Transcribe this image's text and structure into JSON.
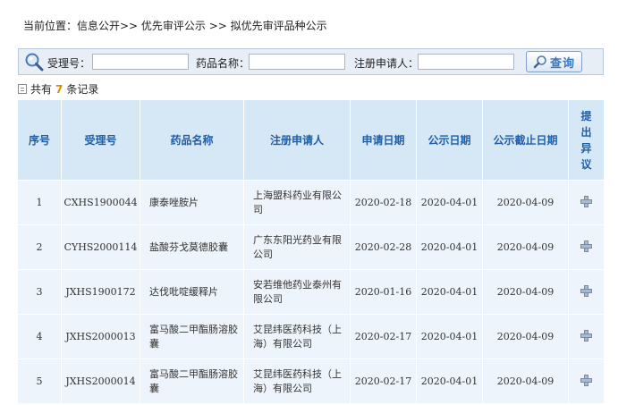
{
  "breadcrumb": {
    "text": "当前位置：信息公开>> 优先审评公示 >> 拟优先审评品种公示"
  },
  "search": {
    "accept_no_label": "受理号：",
    "drug_name_label": "药品名称：",
    "applicant_label": "注册申请人：",
    "accept_no_value": "",
    "drug_name_value": "",
    "applicant_value": "",
    "button_label": "查询",
    "icon": "magnifier-icon"
  },
  "records": {
    "prefix": "共有",
    "count": "7",
    "suffix": "条记录"
  },
  "table": {
    "headers": [
      "序号",
      "受理号",
      "药品名称",
      "注册申请人",
      "申请日期",
      "公示日期",
      "公示截止日期",
      "提出异议"
    ],
    "rows": [
      {
        "no": "1",
        "accept_no": "CXHS1900044",
        "drug": "康泰唑胺片",
        "applicant": "上海盟科药业有限公司",
        "apply_date": "2020-02-18",
        "publish_date": "2020-04-01",
        "deadline": "2020-04-09"
      },
      {
        "no": "2",
        "accept_no": "CYHS2000114",
        "drug": "盐酸芬戈莫德胶囊",
        "applicant": "广东东阳光药业有限公司",
        "apply_date": "2020-02-28",
        "publish_date": "2020-04-01",
        "deadline": "2020-04-09"
      },
      {
        "no": "3",
        "accept_no": "JXHS1900172",
        "drug": "达伐吡啶缓释片",
        "applicant": "安若维他药业泰州有限公司",
        "apply_date": "2020-01-16",
        "publish_date": "2020-04-01",
        "deadline": "2020-04-09"
      },
      {
        "no": "4",
        "accept_no": "JXHS2000013",
        "drug": "富马酸二甲酯肠溶胶囊",
        "applicant": "艾昆纬医药科技（上海）有限公司",
        "apply_date": "2020-02-17",
        "publish_date": "2020-04-01",
        "deadline": "2020-04-09"
      },
      {
        "no": "5",
        "accept_no": "JXHS2000014",
        "drug": "富马酸二甲酯肠溶胶囊",
        "applicant": "艾昆纬医药科技（上海）有限公司",
        "apply_date": "2020-02-17",
        "publish_date": "2020-04-01",
        "deadline": "2020-04-09"
      }
    ]
  },
  "colors": {
    "header_bg": "#d6e7f6",
    "header_text": "#1f5fa8",
    "row_bg": "#eef4fb",
    "count_accent": "#e08a00"
  }
}
